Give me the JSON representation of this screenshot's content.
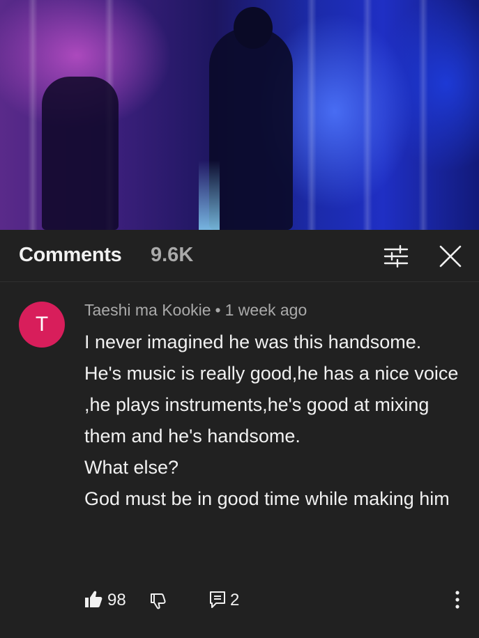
{
  "header": {
    "title": "Comments",
    "count": "9.6K"
  },
  "icons": {
    "filter": "sort-filter-icon",
    "close": "close-icon",
    "like": "thumbs-up-icon",
    "dislike": "thumbs-down-icon",
    "reply": "reply-icon",
    "more": "more-vertical-icon"
  },
  "comment": {
    "avatar_letter": "T",
    "avatar_color": "#d81e5b",
    "author": "Taeshi ma Kookie",
    "time": "1 week ago",
    "lines": [
      "I never imagined he was this handsome.",
      "He's music is really good,he has a nice voice ,he plays instruments,he's good at mixing them and he's handsome.",
      "What else?",
      "God must be in good time while making him"
    ],
    "likes": "98",
    "replies": "2"
  }
}
